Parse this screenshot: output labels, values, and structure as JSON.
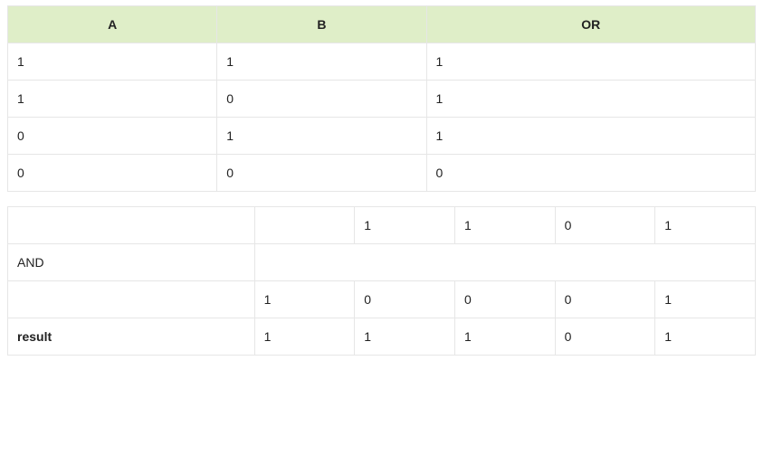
{
  "or_table": {
    "headers": {
      "a": "A",
      "b": "B",
      "or": "OR"
    },
    "rows": [
      {
        "a": "1",
        "b": "1",
        "or": "1"
      },
      {
        "a": "1",
        "b": "0",
        "or": "1"
      },
      {
        "a": "0",
        "b": "1",
        "or": "1"
      },
      {
        "a": "0",
        "b": "0",
        "or": "0"
      }
    ]
  },
  "and_table": {
    "row1": {
      "label": "",
      "v1": "",
      "v2": "1",
      "v3": "1",
      "v4": "0",
      "v5": "1"
    },
    "row2": {
      "label": "AND"
    },
    "row3": {
      "label": "",
      "v1": "1",
      "v2": "0",
      "v3": "0",
      "v4": "0",
      "v5": "1"
    },
    "row4": {
      "label": "result",
      "v1": "1",
      "v2": "1",
      "v3": "1",
      "v4": "0",
      "v5": "1"
    }
  }
}
